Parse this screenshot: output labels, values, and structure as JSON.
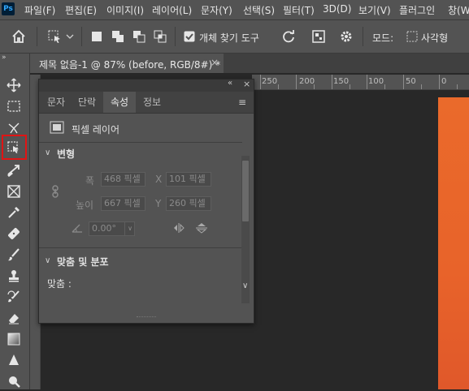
{
  "app": {
    "logo": "Ps"
  },
  "menu": [
    "파일(F)",
    "편집(E)",
    "이미지(I)",
    "레이어(L)",
    "문자(Y)",
    "선택(S)",
    "필터(T)",
    "3D(D)",
    "보기(V)",
    "플러그인",
    "창(W"
  ],
  "options_bar": {
    "checkbox_label": "개체 찾기 도구",
    "mode_label": "모드:",
    "mode_value": "사각형"
  },
  "document": {
    "tab_title": "제목 없음-1 @ 87% (before, RGB/8#) *",
    "close": "×"
  },
  "ruler": {
    "labels": [
      "250",
      "200",
      "150",
      "100",
      "50",
      "0"
    ]
  },
  "properties_panel": {
    "collapse": "«",
    "close": "×",
    "tabs": [
      "문자",
      "단락",
      "속성",
      "정보"
    ],
    "active_tab": "속성",
    "menu_icon": "≡",
    "layer_type": "픽셀 레이어",
    "transform_section": "변형",
    "width_label": "폭",
    "width_value": "468 픽셀",
    "x_label": "X",
    "x_value": "101 픽셀",
    "height_label": "높이",
    "height_value": "667 픽셀",
    "y_label": "Y",
    "y_value": "260 픽셀",
    "angle_value": "0.00°",
    "align_section": "맞춤 및 분포",
    "align_label": "맞춤 :"
  },
  "colors": {
    "canvas_fill": "#e8632a",
    "highlight": "#e01414"
  }
}
